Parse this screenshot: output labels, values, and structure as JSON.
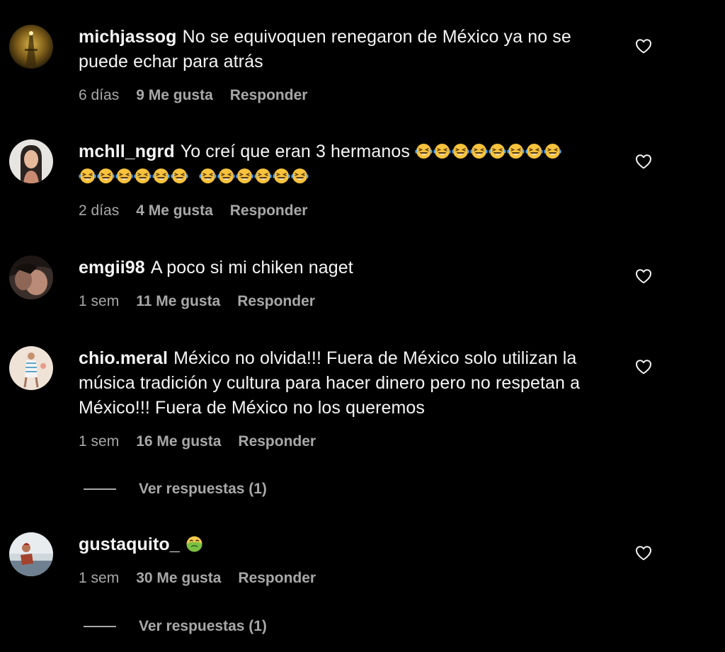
{
  "comments": [
    {
      "username": "michjassog",
      "text": "No se equivoquen renegaron de México ya no se puede echar para atrás",
      "time": "6 días",
      "likes": "9 Me gusta",
      "reply": "Responder",
      "avatar_icon": "avatar-tower-photo"
    },
    {
      "username": "mchll_ngrd",
      "text": "Yo creí que eran 3 hermanos",
      "emoji_groups": [
        8,
        6,
        6
      ],
      "emoji_icon": "face-with-tears-of-joy",
      "time": "2 días",
      "likes": "4 Me gusta",
      "reply": "Responder",
      "avatar_icon": "avatar-woman-photo"
    },
    {
      "username": "emgii98",
      "text": "A poco si mi chiken naget",
      "time": "1 sem",
      "likes": "11 Me gusta",
      "reply": "Responder",
      "avatar_icon": "avatar-couple-photo"
    },
    {
      "username": "chio.meral",
      "text": "México no olvida!!! Fuera de México solo utilizan la música tradición y cultura para hacer dinero pero no respetan a México!!! Fuera de México no los queremos",
      "time": "1 sem",
      "likes": "16 Me gusta",
      "reply": "Responder",
      "view_replies": "Ver respuestas (1)",
      "avatar_icon": "avatar-figure-photo"
    },
    {
      "username": "gustaquito_",
      "text": "",
      "emoji_icon": "nauseated-face",
      "time": "1 sem",
      "likes": "30 Me gusta",
      "reply": "Responder",
      "view_replies": "Ver respuestas (1)",
      "avatar_icon": "avatar-beach-photo"
    }
  ],
  "like_icon": "heart-outline-icon",
  "colors": {
    "background": "#000000",
    "text": "#f5f5f5",
    "secondary": "#a8a8a8",
    "laugh_face": "#f7c23c",
    "tears": "#4fa3f0",
    "nausea_face": "#7ac143"
  }
}
